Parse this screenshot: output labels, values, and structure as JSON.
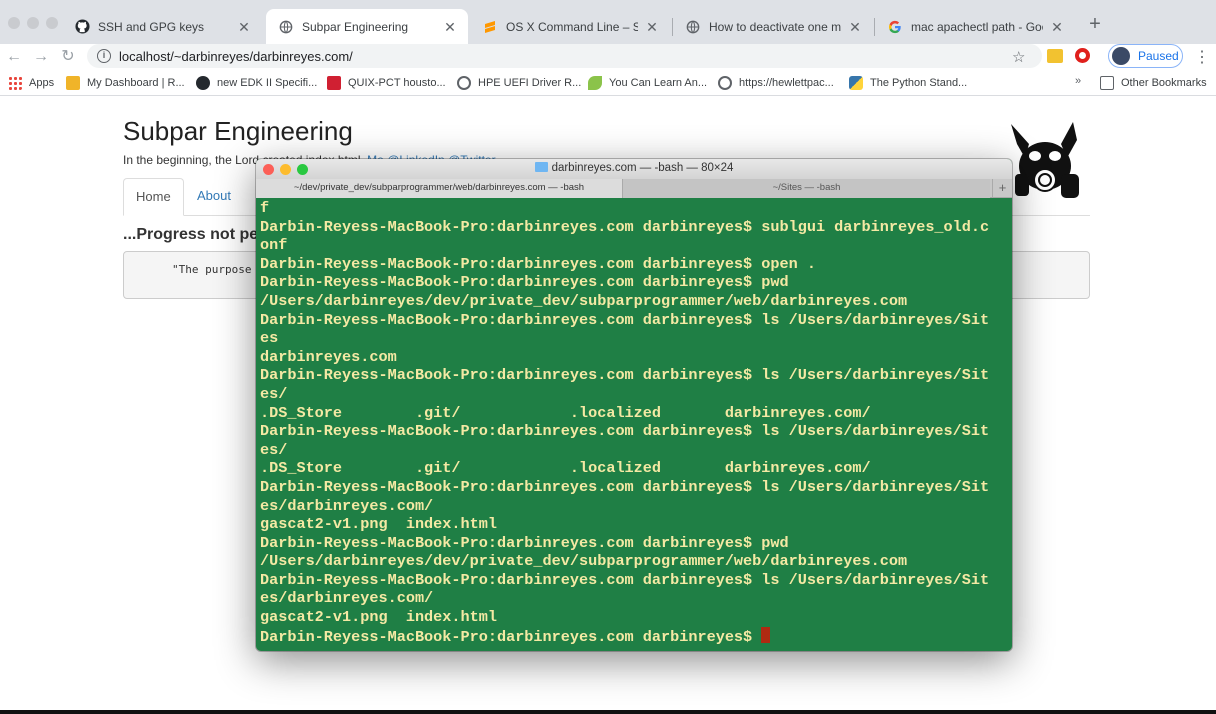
{
  "browser": {
    "tabs": [
      {
        "label": "SSH and GPG keys",
        "icon": "github-icon"
      },
      {
        "label": "Subpar Engineering",
        "icon": "globe-icon"
      },
      {
        "label": "OS X Command Line – Sublime",
        "icon": "sublime-icon"
      },
      {
        "label": "How to deactivate one macpor",
        "icon": "globe-icon"
      },
      {
        "label": "mac apachectl path - Google S",
        "icon": "google-icon"
      }
    ],
    "url": "localhost/~darbinreyes/darbinreyes.com/",
    "profile_status": "Paused",
    "bookmarks": [
      {
        "label": "Apps"
      },
      {
        "label": "My Dashboard | R..."
      },
      {
        "label": "new EDK II Specifi..."
      },
      {
        "label": "QUIX-PCT housto..."
      },
      {
        "label": "HPE UEFI Driver R..."
      },
      {
        "label": "You Can Learn An..."
      },
      {
        "label": "https://hewlettpac..."
      },
      {
        "label": "The Python Stand..."
      }
    ],
    "other_bookmarks": "Other Bookmarks"
  },
  "page": {
    "title": "Subpar Engineering",
    "subtitle": "In the beginning, the Lord created index.html.",
    "subtitle_links": "Me @LinkedIn @Twitter",
    "nav": {
      "home": "Home",
      "about": "About"
    },
    "heading": "...Progress not perfection...",
    "quote": "\"The purpose"
  },
  "terminal": {
    "title": "darbinreyes.com — -bash — 80×24",
    "tabs": [
      "~/dev/private_dev/subparprogrammer/web/darbinreyes.com — -bash",
      "~/Sites — -bash"
    ],
    "lines": [
      "f",
      "Darbin-Reyess-MacBook-Pro:darbinreyes.com darbinreyes$ sublgui darbinreyes_old.c",
      "onf",
      "Darbin-Reyess-MacBook-Pro:darbinreyes.com darbinreyes$ open .",
      "Darbin-Reyess-MacBook-Pro:darbinreyes.com darbinreyes$ pwd",
      "/Users/darbinreyes/dev/private_dev/subparprogrammer/web/darbinreyes.com",
      "Darbin-Reyess-MacBook-Pro:darbinreyes.com darbinreyes$ ls /Users/darbinreyes/Sit",
      "es",
      "darbinreyes.com",
      "Darbin-Reyess-MacBook-Pro:darbinreyes.com darbinreyes$ ls /Users/darbinreyes/Sit",
      "es/",
      ".DS_Store        .git/            .localized       darbinreyes.com/",
      "Darbin-Reyess-MacBook-Pro:darbinreyes.com darbinreyes$ ls /Users/darbinreyes/Sit",
      "es/",
      ".DS_Store        .git/            .localized       darbinreyes.com/",
      "Darbin-Reyess-MacBook-Pro:darbinreyes.com darbinreyes$ ls /Users/darbinreyes/Sit",
      "es/darbinreyes.com/",
      "gascat2-v1.png  index.html",
      "Darbin-Reyess-MacBook-Pro:darbinreyes.com darbinreyes$ pwd",
      "/Users/darbinreyes/dev/private_dev/subparprogrammer/web/darbinreyes.com",
      "Darbin-Reyess-MacBook-Pro:darbinreyes.com darbinreyes$ ls /Users/darbinreyes/Sit",
      "es/darbinreyes.com/",
      "gascat2-v1.png  index.html"
    ],
    "prompt": "Darbin-Reyess-MacBook-Pro:darbinreyes.com darbinreyes$ "
  },
  "colors": {
    "terminal_bg": "#1f7f45",
    "terminal_text": "#f4e9a4",
    "cursor": "#b02a12",
    "link": "#337ab7"
  }
}
